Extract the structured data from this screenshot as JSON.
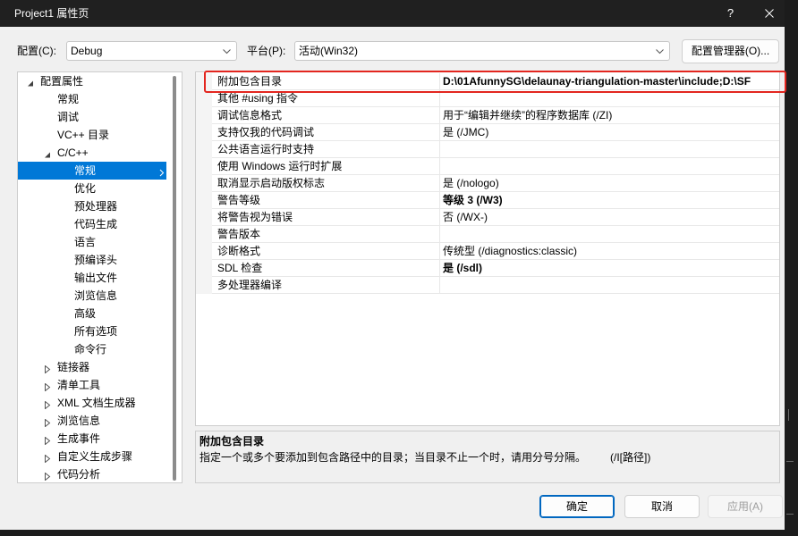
{
  "window": {
    "title": "Project1 属性页",
    "help_label": "?"
  },
  "config_bar": {
    "configuration_label": "配置(C):",
    "configuration_value": "Debug",
    "platform_label": "平台(P):",
    "platform_value": "活动(Win32)",
    "config_manager_button": "配置管理器(O)..."
  },
  "tree": {
    "items": [
      {
        "label": "配置属性",
        "level": 0,
        "expander": "expanded"
      },
      {
        "label": "常规",
        "level": 1,
        "expander": "none"
      },
      {
        "label": "调试",
        "level": 1,
        "expander": "none"
      },
      {
        "label": "VC++ 目录",
        "level": 1,
        "expander": "none"
      },
      {
        "label": "C/C++",
        "level": 1,
        "expander": "expanded"
      },
      {
        "label": "常规",
        "level": 2,
        "expander": "none",
        "selected": true
      },
      {
        "label": "优化",
        "level": 2,
        "expander": "none"
      },
      {
        "label": "预处理器",
        "level": 2,
        "expander": "none"
      },
      {
        "label": "代码生成",
        "level": 2,
        "expander": "none"
      },
      {
        "label": "语言",
        "level": 2,
        "expander": "none"
      },
      {
        "label": "预编译头",
        "level": 2,
        "expander": "none"
      },
      {
        "label": "输出文件",
        "level": 2,
        "expander": "none"
      },
      {
        "label": "浏览信息",
        "level": 2,
        "expander": "none"
      },
      {
        "label": "高级",
        "level": 2,
        "expander": "none"
      },
      {
        "label": "所有选项",
        "level": 2,
        "expander": "none"
      },
      {
        "label": "命令行",
        "level": 2,
        "expander": "none"
      },
      {
        "label": "链接器",
        "level": 1,
        "expander": "collapsed"
      },
      {
        "label": "清单工具",
        "level": 1,
        "expander": "collapsed"
      },
      {
        "label": "XML 文档生成器",
        "level": 1,
        "expander": "collapsed"
      },
      {
        "label": "浏览信息",
        "level": 1,
        "expander": "collapsed"
      },
      {
        "label": "生成事件",
        "level": 1,
        "expander": "collapsed"
      },
      {
        "label": "自定义生成步骤",
        "level": 1,
        "expander": "collapsed"
      },
      {
        "label": "代码分析",
        "level": 1,
        "expander": "collapsed"
      }
    ]
  },
  "grid": {
    "rows": [
      {
        "name": "附加包含目录",
        "value": "D:\\01AfunnySG\\delaunay-triangulation-master\\include;D:\\SF",
        "bold": true
      },
      {
        "name": "其他 #using 指令"
      },
      {
        "name": "调试信息格式",
        "value": "用于“编辑并继续”的程序数据库 (/ZI)"
      },
      {
        "name": "支持仅我的代码调试",
        "value": "是 (/JMC)"
      },
      {
        "name": "公共语言运行时支持"
      },
      {
        "name": "使用 Windows 运行时扩展"
      },
      {
        "name": "取消显示启动版权标志",
        "value": "是 (/nologo)"
      },
      {
        "name": "警告等级",
        "value": "等级 3 (/W3)",
        "bold": true
      },
      {
        "name": "将警告视为错误",
        "value": "否 (/WX-)"
      },
      {
        "name": "警告版本"
      },
      {
        "name": "诊断格式",
        "value": "传统型 (/diagnostics:classic)"
      },
      {
        "name": "SDL 检查",
        "value": "是 (/sdl)",
        "bold": true
      },
      {
        "name": "多处理器编译"
      }
    ]
  },
  "description": {
    "title": "附加包含目录",
    "text": "指定一个或多个要添加到包含路径中的目录；当目录不止一个时，请用分号分隔。",
    "switch": "(/I[路径])"
  },
  "buttons": {
    "ok": "确定",
    "cancel": "取消",
    "apply": "应用(A)",
    "apply_enabled": false
  },
  "icons": {
    "close": "close-icon",
    "dropdown": "chevron-down-icon",
    "expanded": "expanded-triangle-icon",
    "collapsed": "collapsed-triangle-icon",
    "selected_arrow": "chevron-right-icon"
  },
  "colors": {
    "title_bar": "#202020",
    "dialog_background": "#f0f0f0",
    "selection": "#0078d7",
    "annotation_box": "#e3261f",
    "default_button_border": "#0067c0"
  }
}
